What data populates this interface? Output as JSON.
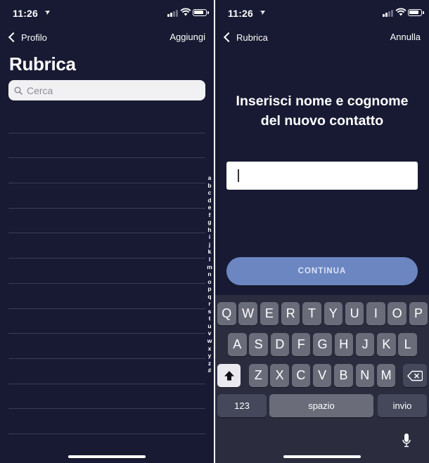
{
  "left": {
    "status": {
      "time": "11:26"
    },
    "nav": {
      "back_label": "Profilo",
      "action_label": "Aggiungi"
    },
    "title": "Rubrica",
    "search": {
      "placeholder": "Cerca"
    },
    "index_letters": [
      "a",
      "b",
      "c",
      "d",
      "e",
      "f",
      "g",
      "h",
      "i",
      "j",
      "k",
      "l",
      "m",
      "n",
      "o",
      "p",
      "q",
      "r",
      "s",
      "t",
      "u",
      "v",
      "w",
      "x",
      "y",
      "z",
      "#"
    ]
  },
  "right": {
    "status": {
      "time": "11:26"
    },
    "nav": {
      "back_label": "Rubrica",
      "action_label": "Annulla"
    },
    "heading": "Inserisci nome e cognome del nuovo contatto",
    "name_input": {
      "value": ""
    },
    "continue_label": "CONTINUA",
    "keyboard": {
      "row1": [
        "Q",
        "W",
        "E",
        "R",
        "T",
        "Y",
        "U",
        "I",
        "O",
        "P"
      ],
      "row2": [
        "A",
        "S",
        "D",
        "F",
        "G",
        "H",
        "J",
        "K",
        "L"
      ],
      "row3": [
        "Z",
        "X",
        "C",
        "V",
        "B",
        "N",
        "M"
      ],
      "numbers_label": "123",
      "space_label": "spazio",
      "return_label": "invio"
    }
  },
  "colors": {
    "background": "#181a33",
    "continue_button": "#6b86c1",
    "keyboard": "#2b2d3f"
  }
}
